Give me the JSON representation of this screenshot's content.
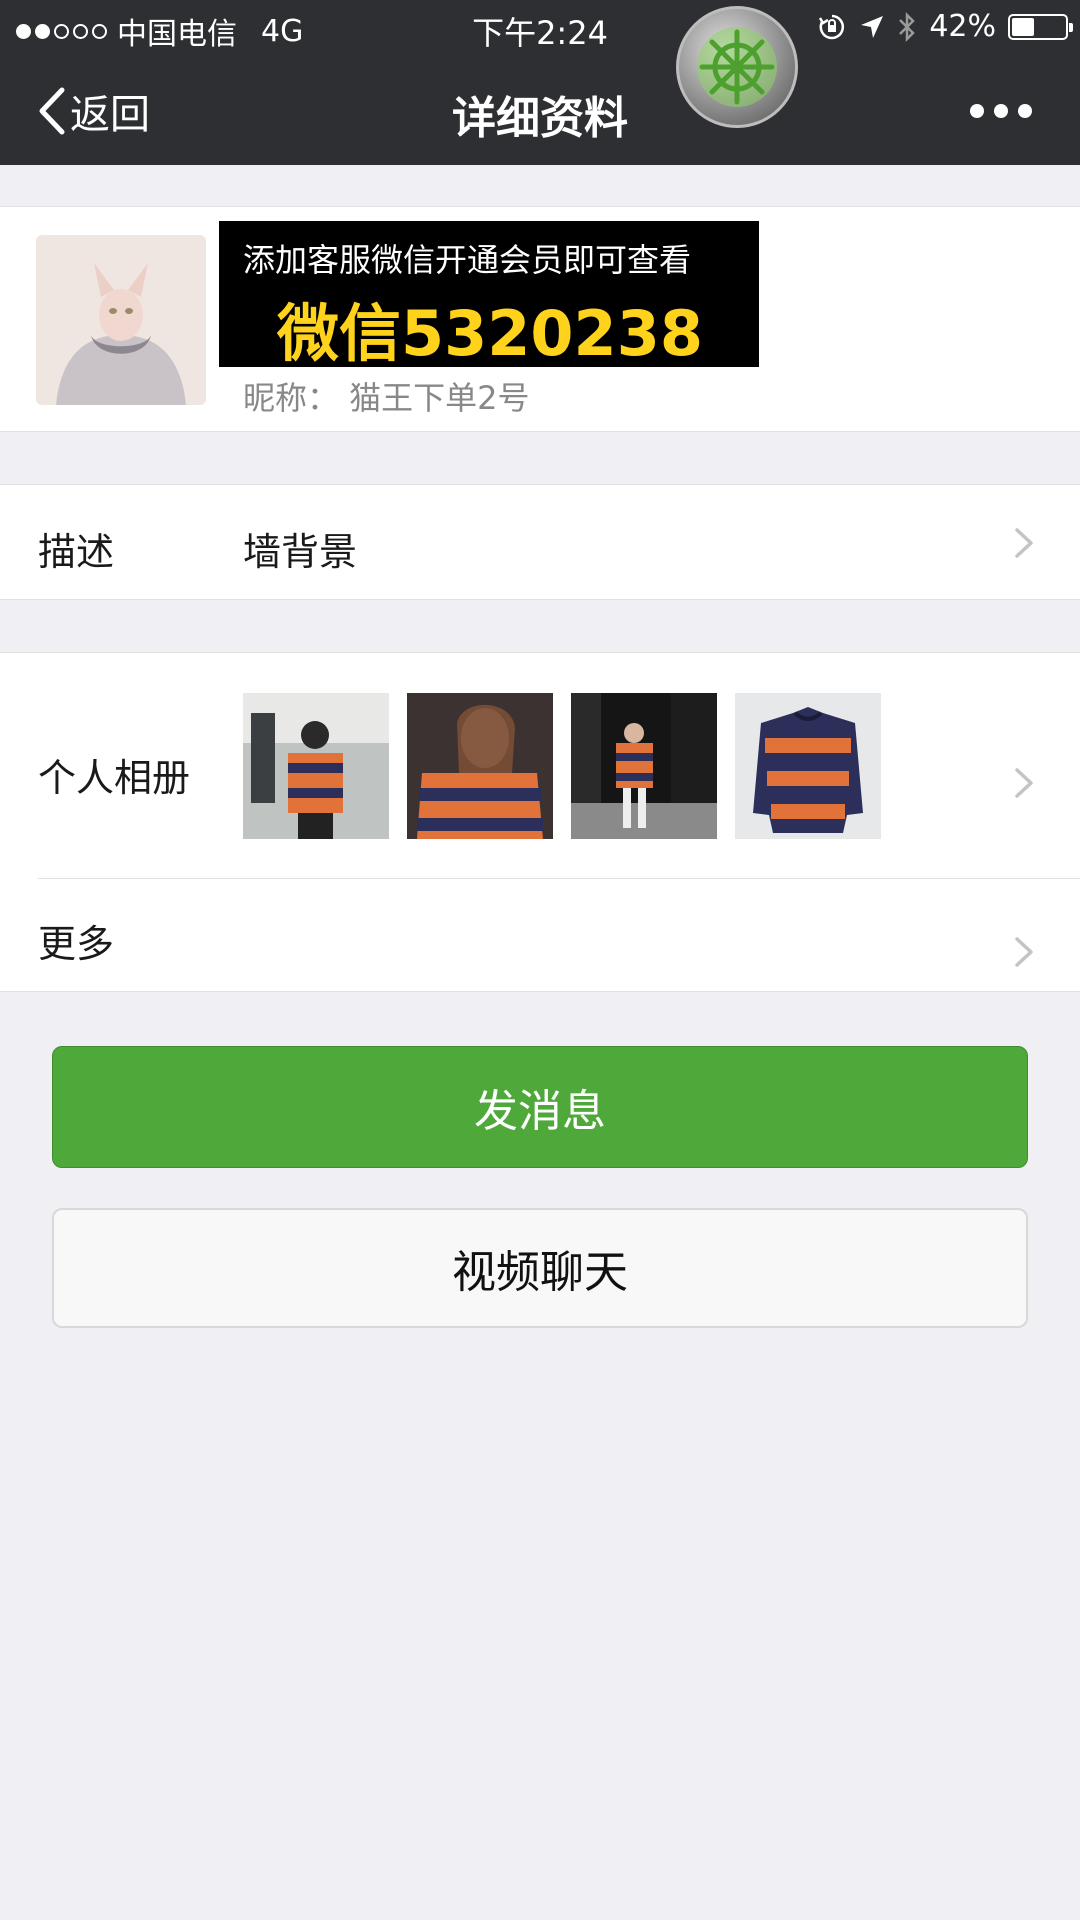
{
  "status_bar": {
    "carrier": "中国电信",
    "network": "4G",
    "time": "下午2:24",
    "battery": "42%",
    "battery_level": 0.42
  },
  "nav": {
    "back_label": "返回",
    "title": "详细资料"
  },
  "profile": {
    "banner_line1": "添加客服微信开通会员即可查看",
    "banner_line2": "微信5320238",
    "nickname": "昵称：  猫王下单2号"
  },
  "description": {
    "label": "描述",
    "value": "墙背景"
  },
  "album": {
    "label": "个人相册",
    "photos": [
      "sweater-photo",
      "sweater-photo",
      "sweater-photo",
      "sweater-photo"
    ]
  },
  "more": {
    "label": "更多"
  },
  "actions": {
    "message_label": "发消息",
    "video_label": "视频聊天"
  },
  "colors": {
    "header_bg": "#2e2f33",
    "primary_button": "#4fa93a",
    "banner_text": "#ffd21c",
    "page_bg": "#efeff4"
  }
}
